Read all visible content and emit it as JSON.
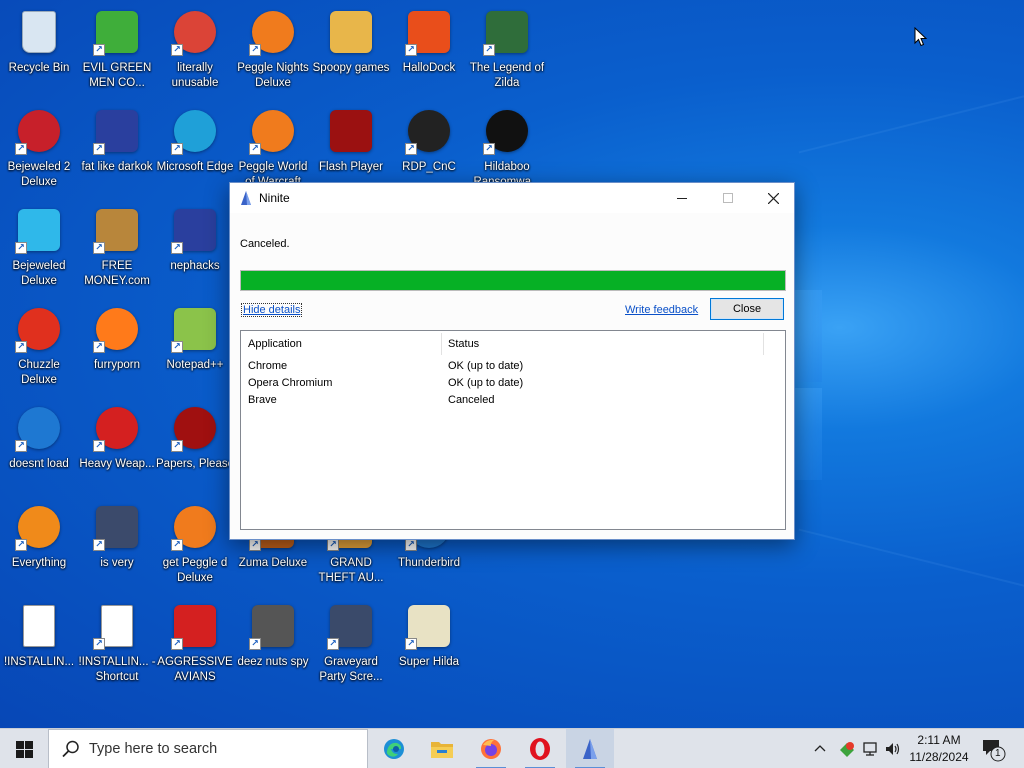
{
  "desktop": {
    "icons": [
      {
        "label": "Recycle Bin",
        "icon": "recycle-bin-icon",
        "color": "#d9e6f2"
      },
      {
        "label": "EVIL GREEN MEN CO...",
        "icon": "people-icon",
        "color": "#3fae3a"
      },
      {
        "label": "literally unusable",
        "icon": "chrome-icon",
        "color": "#db4437"
      },
      {
        "label": "Peggle Nights Deluxe",
        "icon": "peggle-icon",
        "color": "#f07b1d"
      },
      {
        "label": "Spoopy games",
        "icon": "folder-icon",
        "color": "#e8b64a"
      },
      {
        "label": "HalloDock",
        "icon": "windows-shield-icon",
        "color": "#e94e1b"
      },
      {
        "label": "The Legend of Zilda",
        "icon": "character-icon",
        "color": "#2f6d3a"
      },
      {
        "label": "Bejeweled 2 Deluxe",
        "icon": "bejeweled2-icon",
        "color": "#c7202a"
      },
      {
        "label": "fat like darkok",
        "icon": "mpi-icon",
        "color": "#2a3f9e"
      },
      {
        "label": "Microsoft Edge",
        "icon": "edge-icon",
        "color": "#1fa0d8"
      },
      {
        "label": "Peggle World of Warcraft",
        "icon": "peggle-icon",
        "color": "#f07b1d"
      },
      {
        "label": "Flash Player",
        "icon": "flash-icon",
        "color": "#9b1111"
      },
      {
        "label": "RDP_CnC",
        "icon": "rdp-icon",
        "color": "#222222"
      },
      {
        "label": "Hildaboo Ransomwa...",
        "icon": "yashma-icon",
        "color": "#111111"
      },
      {
        "label": "Bejeweled Deluxe",
        "icon": "gem-icon",
        "color": "#2fb8ea"
      },
      {
        "label": "FREE MONEY.com",
        "icon": "money-bag-icon",
        "color": "#b8863b"
      },
      {
        "label": "nephacks",
        "icon": "mpi-icon",
        "color": "#2a3f9e"
      },
      {
        "label": "Chuzzle Deluxe",
        "icon": "chuzzle-icon",
        "color": "#e0301e"
      },
      {
        "label": "furryporn",
        "icon": "firefox-icon",
        "color": "#ff7a1a"
      },
      {
        "label": "Notepad++",
        "icon": "notepadpp-icon",
        "color": "#8bc34a"
      },
      {
        "label": "doesnt load",
        "icon": "thunderbird-icon",
        "color": "#1e78d2"
      },
      {
        "label": "Heavy Weap...",
        "icon": "radiation-icon",
        "color": "#d42020"
      },
      {
        "label": "Papers, Please",
        "icon": "papers-icon",
        "color": "#a01010"
      },
      {
        "label": "Everything",
        "icon": "search-ring-icon",
        "color": "#f08a1a"
      },
      {
        "label": "is very",
        "icon": "mpi-shield-icon",
        "color": "#3b4a6b"
      },
      {
        "label": "get Peggle d Deluxe",
        "icon": "peggle-icon",
        "color": "#f07b1d"
      },
      {
        "label": "Zuma Deluxe",
        "icon": "zuma-icon",
        "color": "#c0601a"
      },
      {
        "label": "GRAND THEFT AU...",
        "icon": "gta-icon",
        "color": "#e6a23a"
      },
      {
        "label": "Thunderbird",
        "icon": "thunderbird-icon",
        "color": "#1e78d2"
      },
      {
        "label": "!INSTALLIN...",
        "icon": "text-file-icon",
        "color": "#ffffff"
      },
      {
        "label": "!INSTALLIN... - Shortcut",
        "icon": "text-file-icon",
        "color": "#ffffff"
      },
      {
        "label": "AGGRESSIVE AVIANS",
        "icon": "angry-bird-icon",
        "color": "#d42020"
      },
      {
        "label": "deez nuts spy",
        "icon": "windows-stack-icon",
        "color": "#555555"
      },
      {
        "label": "Graveyard Party Scre...",
        "icon": "graveyard-icon",
        "color": "#3a4a6a"
      },
      {
        "label": "Super Hilda",
        "icon": "pixel-character-icon",
        "color": "#e8e2c4"
      }
    ]
  },
  "window": {
    "title": "Ninite",
    "minimize": "—",
    "maximize": "☐",
    "close": "✕",
    "status": "Canceled.",
    "progress_percent": 100,
    "progress_color": "#06b025",
    "hide_details": "Hide details",
    "write_feedback": "Write feedback",
    "close_button": "Close",
    "columns": [
      "Application",
      "Status"
    ],
    "rows": [
      {
        "app": "Chrome",
        "status": "OK (up to date)"
      },
      {
        "app": "Opera Chromium",
        "status": "OK (up to date)"
      },
      {
        "app": "Brave",
        "status": "Canceled"
      }
    ]
  },
  "taskbar": {
    "search_placeholder": "Type here to search",
    "apps": [
      {
        "name": "edge-icon",
        "running": false
      },
      {
        "name": "file-explorer-icon",
        "running": false
      },
      {
        "name": "firefox-icon",
        "running": true
      },
      {
        "name": "opera-icon",
        "running": true
      },
      {
        "name": "ninite-icon",
        "running": true,
        "active": true
      }
    ],
    "tray_chevron": "^",
    "time": "2:11 AM",
    "date": "11/28/2024",
    "notification_count": "1"
  }
}
